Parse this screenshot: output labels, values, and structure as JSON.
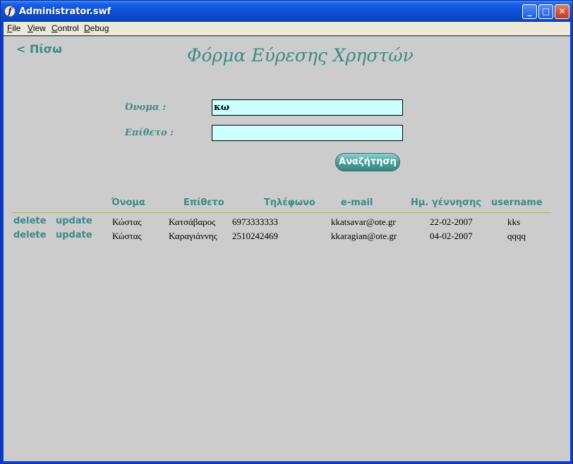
{
  "window": {
    "title": "Administrator.swf",
    "app_icon": "f",
    "min_glyph": "_",
    "max_glyph": "□",
    "close_glyph": "✕"
  },
  "menu": {
    "items": [
      {
        "first": "F",
        "rest": "ile"
      },
      {
        "first": "V",
        "rest": "iew"
      },
      {
        "first": "C",
        "rest": "ontrol"
      },
      {
        "first": "D",
        "rest": "ebug"
      }
    ]
  },
  "page": {
    "back_label": "< Πίσω",
    "title": "Φόρμα Εύρεσης Χρηστών",
    "name_label": "Όνομα :",
    "name_value": "κω",
    "surname_label": "Επίθετο :",
    "surname_value": "",
    "search_label": "Αναζήτηση"
  },
  "table": {
    "headers": [
      "Όνομα",
      "Επίθετο",
      "Τηλέφωνο",
      "e-mail",
      "Ημ. γέννησης",
      "username"
    ],
    "delete_label": "delete",
    "update_label": "update",
    "rows": [
      {
        "name": "Κώστας",
        "surname": "Κατσάβαρος",
        "phone": "6973333333",
        "email": "kkatsavar@ote.gr",
        "birthdate": "22-02-2007",
        "username": "kks"
      },
      {
        "name": "Κώστας",
        "surname": "Καραγιάννης",
        "phone": "2510242469",
        "email": "kkaragian@ote.gr",
        "birthdate": "04-02-2007",
        "username": "qqqq"
      }
    ]
  },
  "colors": {
    "accent": "#3d8a87",
    "field_bg": "#ccffff",
    "stage_bg": "#cccccc",
    "titlebar": "#0d4fd8"
  }
}
